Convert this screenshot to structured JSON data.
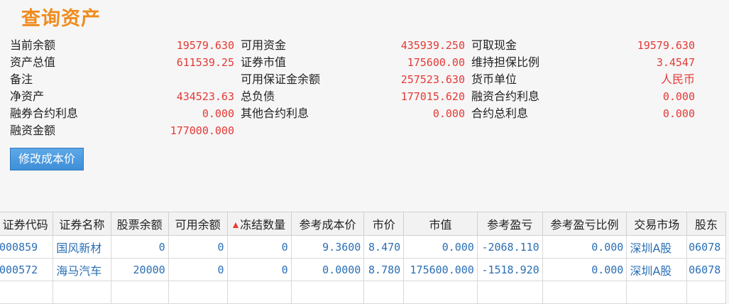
{
  "title": "查询资产",
  "summary": [
    [
      {
        "label": "当前余额",
        "value": "19579.630"
      },
      {
        "label": "可用资金",
        "value": "435939.250"
      },
      {
        "label": "可取现金",
        "value": "19579.630"
      }
    ],
    [
      {
        "label": "资产总值",
        "value": "611539.25"
      },
      {
        "label": "证券市值",
        "value": "175600.00"
      },
      {
        "label": "维持担保比例",
        "value": "3.4547"
      }
    ],
    [
      {
        "label": "备注",
        "value": ""
      },
      {
        "label": "可用保证金余额",
        "value": "257523.630"
      },
      {
        "label": "货币单位",
        "value": "人民币"
      }
    ],
    [
      {
        "label": "净资产",
        "value": "434523.63"
      },
      {
        "label": "总负债",
        "value": "177015.620"
      },
      {
        "label": "融资合约利息",
        "value": "0.000"
      }
    ],
    [
      {
        "label": "融券合约利息",
        "value": "0.000"
      },
      {
        "label": "其他合约利息",
        "value": "0.000"
      },
      {
        "label": "合约总利息",
        "value": "0.000"
      }
    ],
    [
      {
        "label": "融资金额",
        "value": "177000.000"
      }
    ]
  ],
  "edit_button": "修改成本价",
  "table": {
    "columns": [
      "证券代码",
      "证券名称",
      "股票余额",
      "可用余额",
      "冻结数量",
      "参考成本价",
      "市价",
      "市值",
      "参考盈亏",
      "参考盈亏比例",
      "交易市场",
      "股东"
    ],
    "rows": [
      [
        "000859",
        "国风新材",
        "0",
        "0",
        "0",
        "9.3600",
        "8.470",
        "0.000",
        "-2068.110",
        "0.000",
        "深圳A股",
        "06078"
      ],
      [
        "000572",
        "海马汽车",
        "20000",
        "0",
        "0",
        "0.0000",
        "8.780",
        "175600.000",
        "-1518.920",
        "0.000",
        "深圳A股",
        "06078"
      ]
    ]
  }
}
